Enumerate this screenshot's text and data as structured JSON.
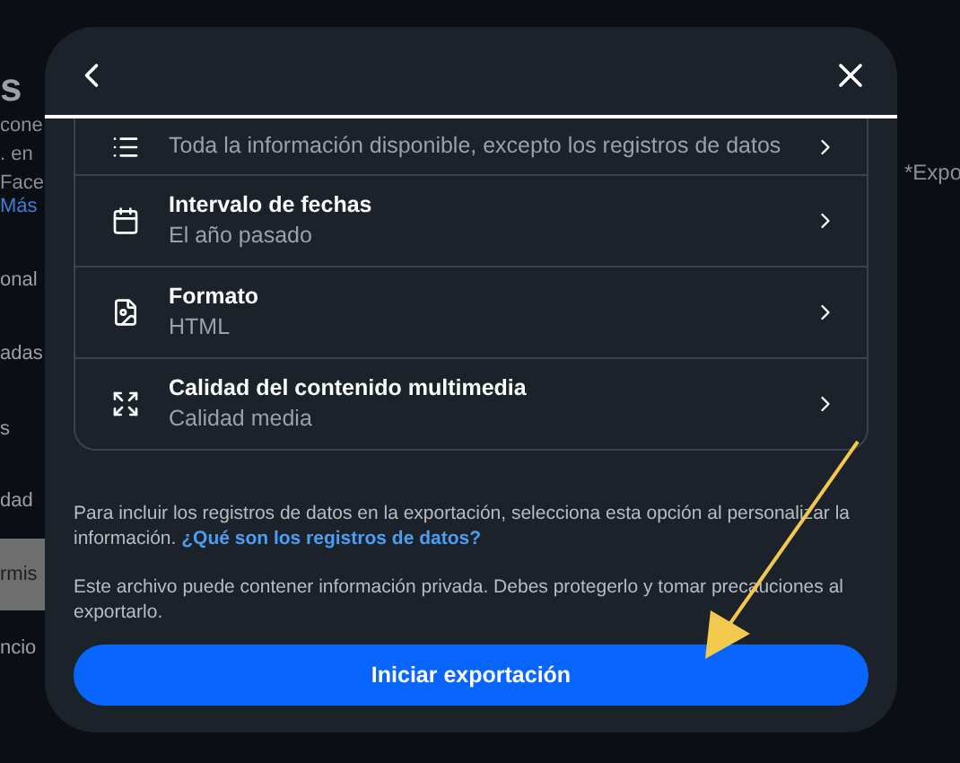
{
  "background": {
    "heading": "s",
    "left_texts": [
      "cone",
      ". en",
      "Face"
    ],
    "left_link": "Más",
    "left_menu": [
      {
        "label": "onal",
        "selected": false
      },
      {
        "label": "adas",
        "selected": false
      },
      {
        "label": "s",
        "selected": false
      },
      {
        "label": "dad",
        "selected": false
      },
      {
        "label": "rmis",
        "selected": true
      },
      {
        "label": "ncio",
        "selected": false
      }
    ],
    "right_text": "*Expo"
  },
  "dialog": {
    "options": [
      {
        "subtitle": "Toda la información disponible, excepto los registros de datos"
      },
      {
        "title": "Intervalo de fechas",
        "subtitle": "El año pasado"
      },
      {
        "title": "Formato",
        "subtitle": "HTML"
      },
      {
        "title": "Calidad del contenido multimedia",
        "subtitle": "Calidad media"
      }
    ],
    "note": "Para incluir los registros de datos en la exportación, selecciona esta opción al personalizar la información.",
    "note_link": "¿Qué son los registros de datos?",
    "warning": "Este archivo puede contener información privada. Debes protegerlo y tomar precauciones al exportarlo.",
    "button": "Iniciar exportación"
  }
}
